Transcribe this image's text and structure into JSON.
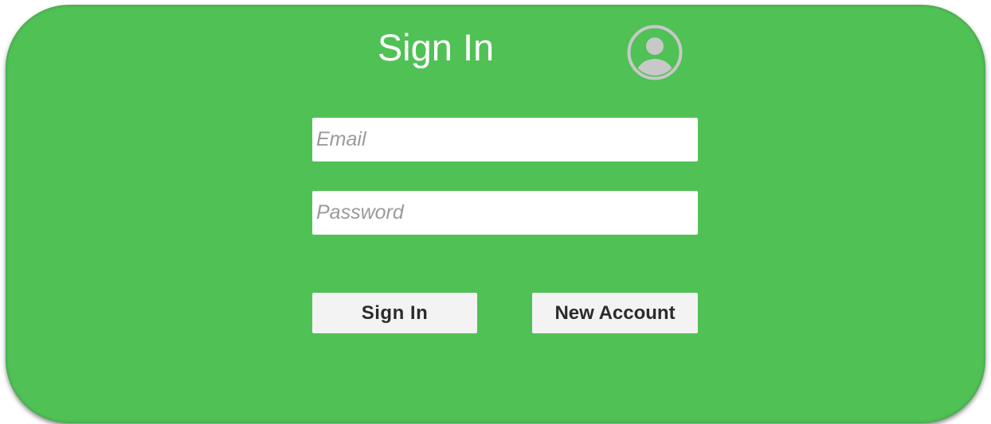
{
  "form": {
    "title": "Sign In",
    "email_placeholder": "Email",
    "password_placeholder": "Password",
    "sign_in_label": "Sign In",
    "new_account_label": "New Account"
  },
  "icons": {
    "avatar": "user-circle-icon"
  },
  "colors": {
    "panel_background": "#50c155",
    "title_text": "#ffffff",
    "avatar": "#c8c8c8",
    "button_background": "#f3f3f3",
    "button_text": "#2b2b2b",
    "placeholder_text": "#9a9a9a"
  }
}
